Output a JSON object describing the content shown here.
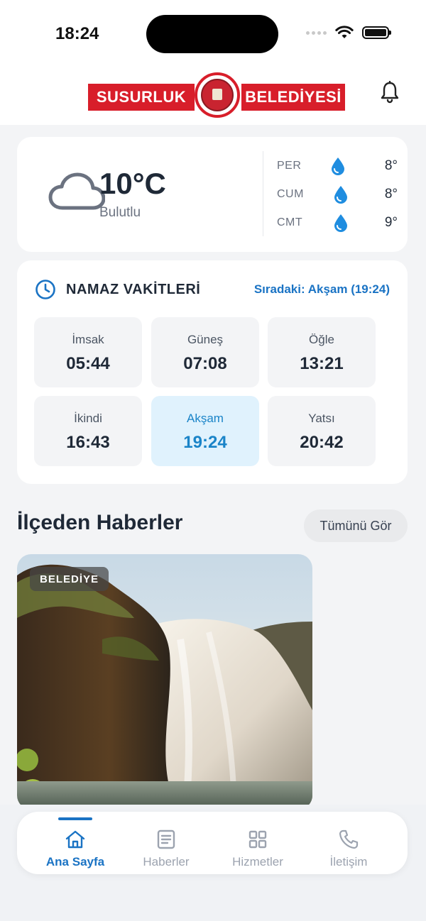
{
  "status_bar": {
    "time": "18:24"
  },
  "header": {
    "logo_left": "SUSURLUK",
    "logo_right": "BELEDİYESİ"
  },
  "weather": {
    "temperature": "10°C",
    "condition": "Bulutlu",
    "icon": "cloud-icon",
    "forecast": [
      {
        "day": "PER",
        "icon": "water-drop-icon",
        "temp": "8°"
      },
      {
        "day": "CUM",
        "icon": "water-drop-icon",
        "temp": "8°"
      },
      {
        "day": "CMT",
        "icon": "water-drop-icon",
        "temp": "9°"
      }
    ]
  },
  "prayer_times": {
    "title": "NAMAZ VAKİTLERİ",
    "next_label": "Sıradaki: Akşam (19:24)",
    "items": [
      {
        "name": "İmsak",
        "time": "05:44",
        "active": false
      },
      {
        "name": "Güneş",
        "time": "07:08",
        "active": false
      },
      {
        "name": "Öğle",
        "time": "13:21",
        "active": false
      },
      {
        "name": "İkindi",
        "time": "16:43",
        "active": false
      },
      {
        "name": "Akşam",
        "time": "19:24",
        "active": true
      },
      {
        "name": "Yatsı",
        "time": "20:42",
        "active": false
      }
    ]
  },
  "news": {
    "title": "İlçeden Haberler",
    "see_all": "Tümünü Gör",
    "cards": [
      {
        "badge": "BELEDİYE"
      }
    ]
  },
  "tab_bar": {
    "items": [
      {
        "label": "Ana Sayfa",
        "icon": "home-icon",
        "active": true
      },
      {
        "label": "Haberler",
        "icon": "newspaper-icon",
        "active": false
      },
      {
        "label": "Hizmetler",
        "icon": "grid-icon",
        "active": false
      },
      {
        "label": "İletişim",
        "icon": "phone-icon",
        "active": false
      }
    ]
  },
  "colors": {
    "accent": "#1a73c4",
    "active_prayer_bg": "#e0f2fd",
    "brand_red": "#d81e2a"
  }
}
